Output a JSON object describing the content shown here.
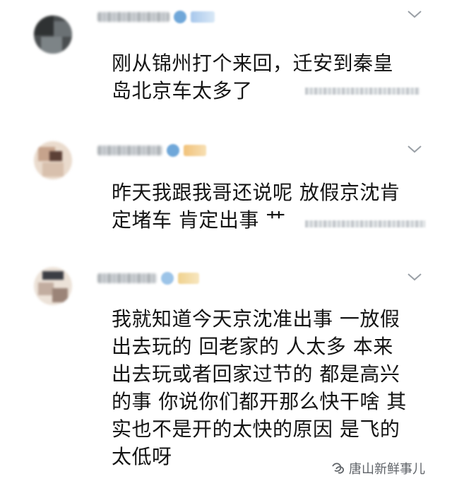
{
  "comments": [
    {
      "lines": [
        "刚从锦州打个来回，迁安到秦皇",
        "岛北京车太多了"
      ],
      "avatar_colors": [
        "#2f3233",
        "#5a5e60",
        "#7d8487",
        "#3f4345"
      ]
    },
    {
      "lines": [
        "昨天我跟我哥还说呢 放假京沈肯",
        "定堵车 肯定出事 艹"
      ],
      "avatar_colors": [
        "#f0e6dc",
        "#caa892",
        "#6f5145",
        "#b99a83"
      ]
    },
    {
      "lines": [
        "我就知道今天京沈准出事 一放假",
        "出去玩的 回老家的 人太多 本来",
        "出去玩或者回家过节的 都是高兴",
        "的事 你说你们都开那么快干啥 其",
        "实也不是开的太快的原因 是飞的",
        "太低呀"
      ],
      "avatar_colors": [
        "#efe6dd",
        "#c2ada0",
        "#3b3d44",
        "#9b8478"
      ]
    }
  ],
  "watermark": {
    "icon": "wechat-channel-icon",
    "text": "唐山新鲜事儿"
  },
  "colors": {
    "text": "#141414",
    "chevron": "#9aa0a6",
    "watermark": "#5f6368"
  }
}
